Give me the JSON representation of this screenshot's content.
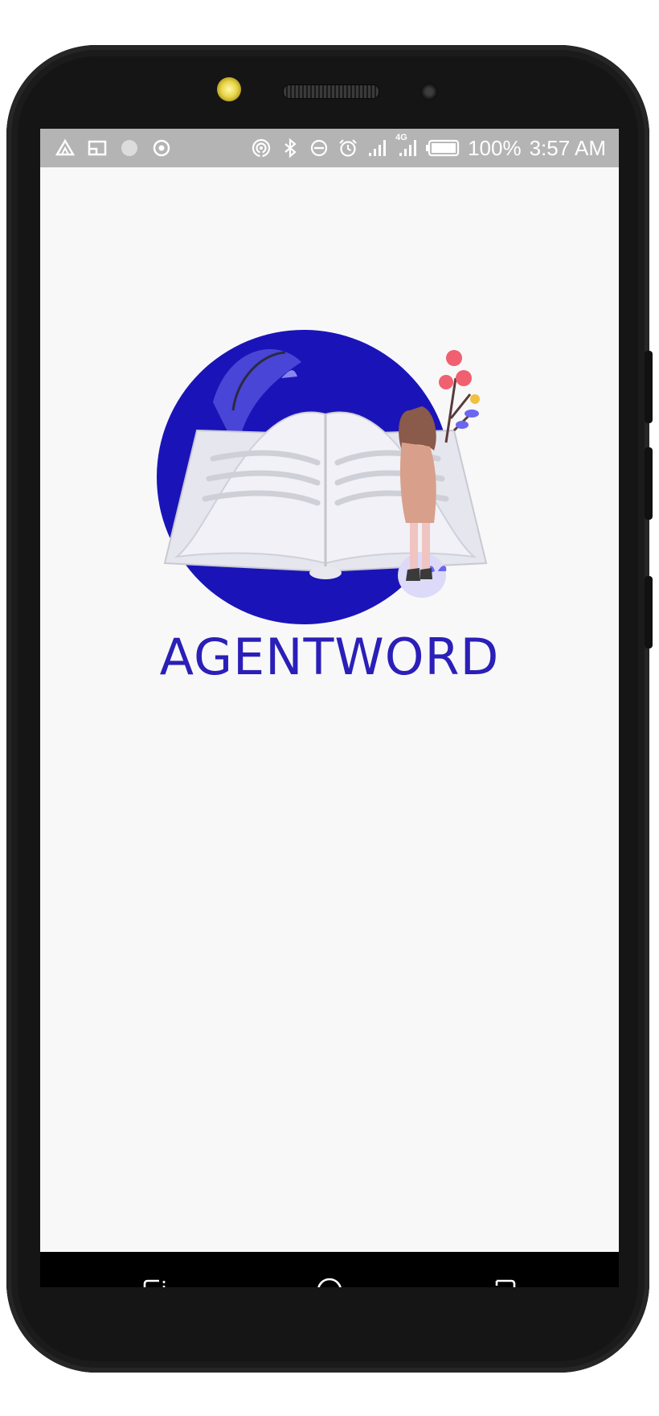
{
  "status_bar": {
    "left_icons": [
      "warning-triangle-icon",
      "cast-icon",
      "circle-dot-icon",
      "target-icon"
    ],
    "right_icons": [
      "hotspot-icon",
      "bluetooth-icon",
      "do-not-disturb-icon",
      "alarm-icon",
      "signal-icon",
      "signal-4g-icon",
      "battery-icon"
    ],
    "network_label": "4G",
    "battery": "100%",
    "time": "3:57 AM"
  },
  "app": {
    "title": "AGENTWORD",
    "title_color": "#2a1fb8",
    "accent": "#1a14b8"
  },
  "nav_bar": {
    "buttons": [
      "recent-apps-icon",
      "home-icon",
      "back-icon"
    ]
  }
}
